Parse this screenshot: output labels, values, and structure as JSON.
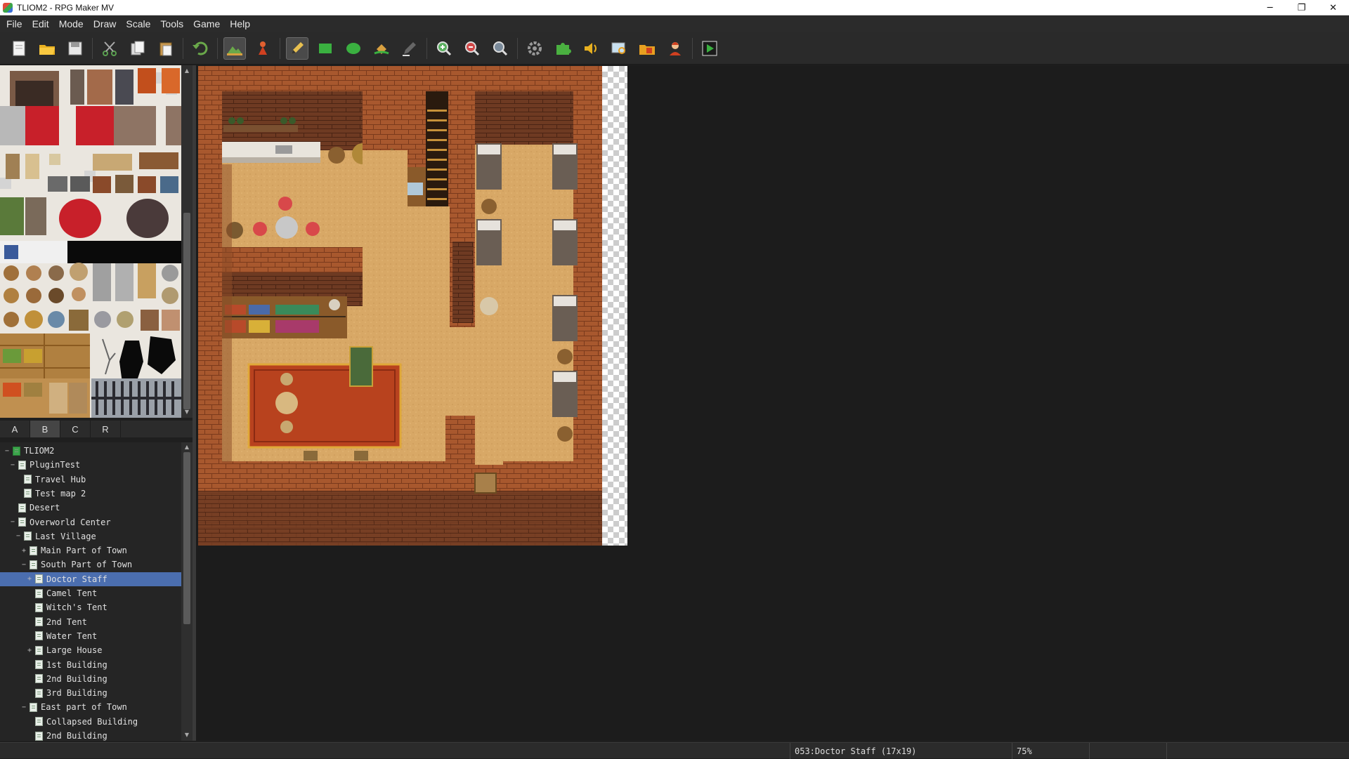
{
  "window": {
    "title": "TLIOM2 - RPG Maker MV",
    "minimize": "─",
    "maximize": "❐",
    "close": "✕"
  },
  "menu": [
    "File",
    "Edit",
    "Mode",
    "Draw",
    "Scale",
    "Tools",
    "Game",
    "Help"
  ],
  "toolbar": {
    "buttons": [
      {
        "icon": "new-project-icon",
        "active": false
      },
      {
        "icon": "open-project-icon",
        "active": false
      },
      {
        "icon": "save-project-icon",
        "active": false
      },
      {
        "icon": "cut-icon",
        "active": false
      },
      {
        "icon": "copy-icon",
        "active": false
      },
      {
        "icon": "paste-icon",
        "active": false
      },
      {
        "icon": "undo-icon",
        "active": false
      },
      {
        "icon": "map-mode-icon",
        "active": true
      },
      {
        "icon": "event-mode-icon",
        "active": false
      },
      {
        "icon": "pencil-icon",
        "active": true
      },
      {
        "icon": "rectangle-icon",
        "active": false
      },
      {
        "icon": "ellipse-icon",
        "active": false
      },
      {
        "icon": "flood-fill-icon",
        "active": false
      },
      {
        "icon": "shadow-pen-icon",
        "active": false
      },
      {
        "icon": "zoom-in-icon",
        "active": false
      },
      {
        "icon": "zoom-out-icon",
        "active": false
      },
      {
        "icon": "actual-size-icon",
        "active": false
      },
      {
        "icon": "database-icon",
        "active": false
      },
      {
        "icon": "plugin-manager-icon",
        "active": false
      },
      {
        "icon": "sound-test-icon",
        "active": false
      },
      {
        "icon": "event-searcher-icon",
        "active": false
      },
      {
        "icon": "resource-manager-icon",
        "active": false
      },
      {
        "icon": "character-generator-icon",
        "active": false
      },
      {
        "icon": "playtest-icon",
        "active": false
      }
    ]
  },
  "tileset_tabs": [
    "A",
    "B",
    "C",
    "R"
  ],
  "tileset_active_tab": "B",
  "map_tree": [
    {
      "label": "TLIOM2",
      "depth": 0,
      "expander": "−",
      "root": true
    },
    {
      "label": "PluginTest",
      "depth": 1,
      "expander": "−"
    },
    {
      "label": "Travel Hub",
      "depth": 2,
      "expander": ""
    },
    {
      "label": "Test map 2",
      "depth": 2,
      "expander": ""
    },
    {
      "label": "Desert",
      "depth": 1,
      "expander": ""
    },
    {
      "label": "Overworld Center",
      "depth": 1,
      "expander": "−"
    },
    {
      "label": "Last Village",
      "depth": 2,
      "expander": "−"
    },
    {
      "label": "Main Part of Town",
      "depth": 3,
      "expander": "+"
    },
    {
      "label": "South Part of Town",
      "depth": 3,
      "expander": "−"
    },
    {
      "label": "Doctor Staff",
      "depth": 4,
      "expander": "+",
      "selected": true
    },
    {
      "label": "Camel Tent",
      "depth": 4,
      "expander": ""
    },
    {
      "label": "Witch's Tent",
      "depth": 4,
      "expander": ""
    },
    {
      "label": "2nd Tent",
      "depth": 4,
      "expander": ""
    },
    {
      "label": "Water Tent",
      "depth": 4,
      "expander": ""
    },
    {
      "label": "Large House",
      "depth": 4,
      "expander": "+"
    },
    {
      "label": "1st Building",
      "depth": 4,
      "expander": ""
    },
    {
      "label": "2nd Building",
      "depth": 4,
      "expander": ""
    },
    {
      "label": "3rd Building",
      "depth": 4,
      "expander": ""
    },
    {
      "label": "East part of Town",
      "depth": 3,
      "expander": "−"
    },
    {
      "label": "Collapsed Building",
      "depth": 4,
      "expander": ""
    },
    {
      "label": "2nd Building",
      "depth": 4,
      "expander": ""
    }
  ],
  "status": {
    "map_info": "053:Doctor Staff (17x19)",
    "zoom": "75%"
  },
  "colors": {
    "brick": "#a0522d",
    "floor": "#d9a866",
    "carpet": "#b8421e",
    "selection": "#4b6eaf"
  }
}
